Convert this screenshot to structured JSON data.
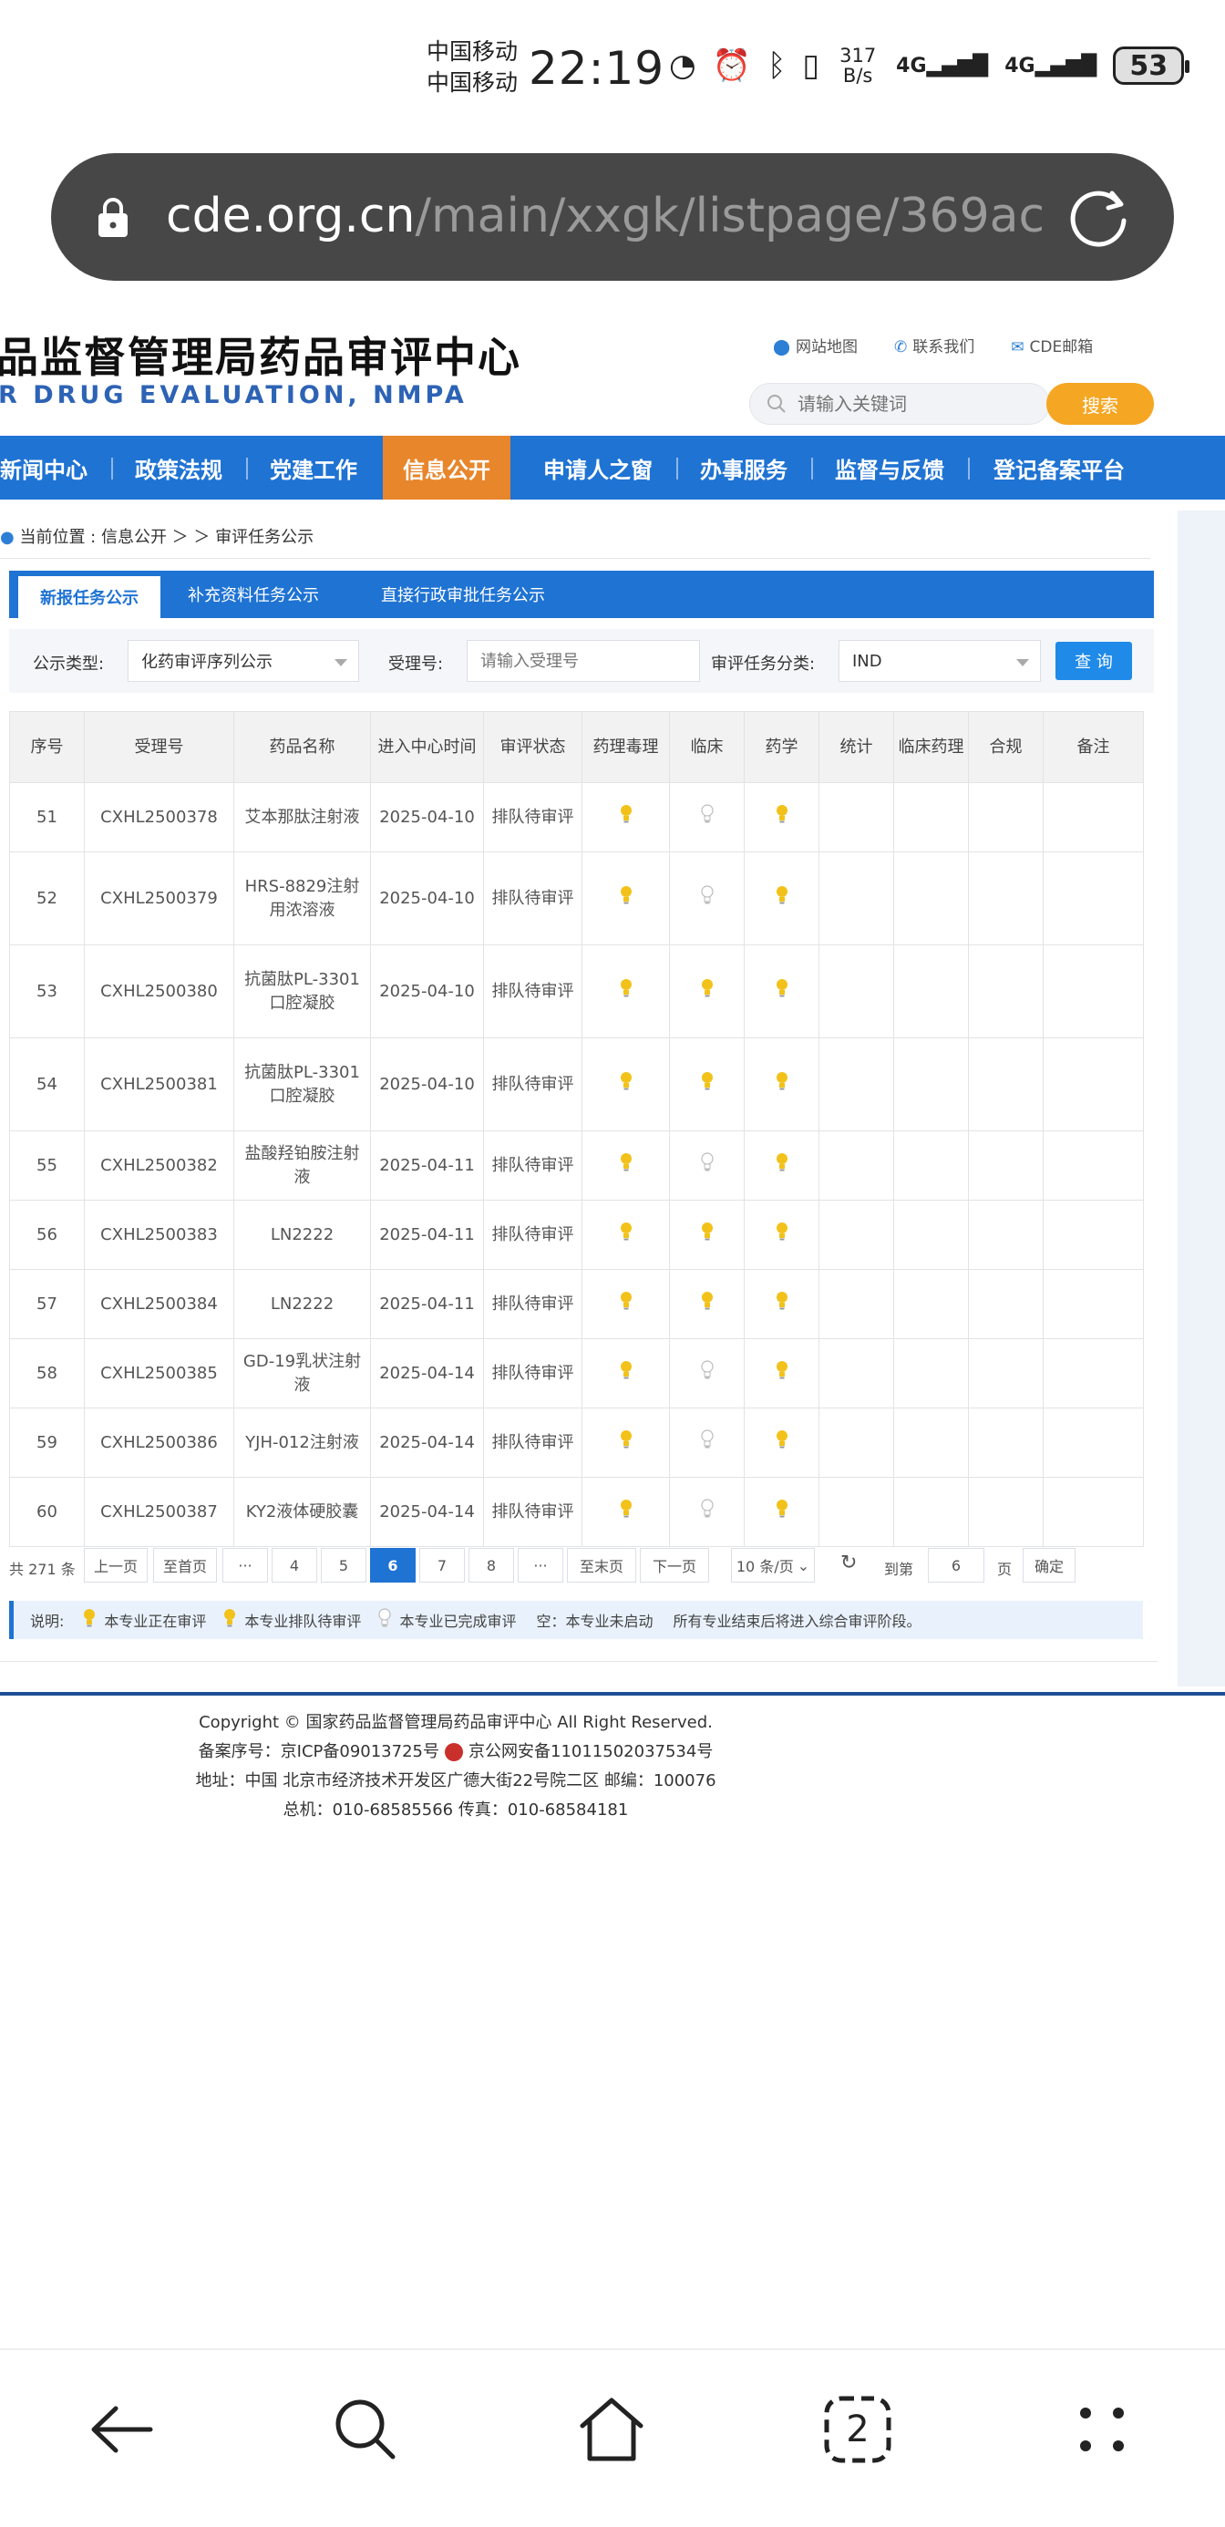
{
  "status_bar": {
    "carrier1": "中国移动",
    "carrier2": "中国移动",
    "time": "22:19",
    "net_speed_value": "317",
    "net_speed_unit": "B/s",
    "network1": "4G",
    "network2": "4G",
    "battery": "53"
  },
  "url_bar": {
    "host": "cde.org.cn",
    "path": "/main/xxgk/listpage/369ac"
  },
  "site": {
    "title": "品监督管理局药品审评中心",
    "subtitle": "R DRUG EVALUATION, NMPA",
    "links": [
      "网站地图",
      "联系我们",
      "CDE邮箱"
    ],
    "search_placeholder": "请输入关键词",
    "search_button": "搜索"
  },
  "nav": {
    "items": [
      "新闻中心",
      "政策法规",
      "党建工作",
      "信息公开",
      "申请人之窗",
      "办事服务",
      "监督与反馈",
      "登记备案平台"
    ],
    "active": "信息公开"
  },
  "breadcrumb": "当前位置 : 信息公开 ＞ ＞ 审评任务公示",
  "tabs": [
    "新报任务公示",
    "补充资料任务公示",
    "直接行政审批任务公示"
  ],
  "filter": {
    "type_label": "公示类型:",
    "type_value": "化药审评序列公示",
    "accept_label": "受理号:",
    "accept_placeholder": "请输入受理号",
    "category_label": "审评任务分类:",
    "category_value": "IND",
    "query_button": "查 询"
  },
  "table": {
    "headers": [
      "序号",
      "受理号",
      "药品名称",
      "进入中心时间",
      "审评状态",
      "药理毒理",
      "临床",
      "药学",
      "统计",
      "临床药理",
      "合规",
      "备注"
    ],
    "rows": [
      {
        "no": "51",
        "id": "CXHL2500378",
        "name": "艾本那肽注射液",
        "date": "2025-04-10",
        "status": "排队待审评",
        "pharm": "y",
        "clin": "w",
        "chem": "y"
      },
      {
        "no": "52",
        "id": "CXHL2500379",
        "name": "HRS-8829注射用浓溶液",
        "date": "2025-04-10",
        "status": "排队待审评",
        "pharm": "y",
        "clin": "w",
        "chem": "y"
      },
      {
        "no": "53",
        "id": "CXHL2500380",
        "name": "抗菌肽PL-3301口腔凝胶",
        "date": "2025-04-10",
        "status": "排队待审评",
        "pharm": "y",
        "clin": "y",
        "chem": "y"
      },
      {
        "no": "54",
        "id": "CXHL2500381",
        "name": "抗菌肽PL-3301口腔凝胶",
        "date": "2025-04-10",
        "status": "排队待审评",
        "pharm": "y",
        "clin": "y",
        "chem": "y"
      },
      {
        "no": "55",
        "id": "CXHL2500382",
        "name": "盐酸羟铂胺注射液",
        "date": "2025-04-11",
        "status": "排队待审评",
        "pharm": "y",
        "clin": "w",
        "chem": "y"
      },
      {
        "no": "56",
        "id": "CXHL2500383",
        "name": "LN2222",
        "date": "2025-04-11",
        "status": "排队待审评",
        "pharm": "y",
        "clin": "y",
        "chem": "y"
      },
      {
        "no": "57",
        "id": "CXHL2500384",
        "name": "LN2222",
        "date": "2025-04-11",
        "status": "排队待审评",
        "pharm": "y",
        "clin": "y",
        "chem": "y"
      },
      {
        "no": "58",
        "id": "CXHL2500385",
        "name": "GD-19乳状注射液",
        "date": "2025-04-14",
        "status": "排队待审评",
        "pharm": "y",
        "clin": "w",
        "chem": "y"
      },
      {
        "no": "59",
        "id": "CXHL2500386",
        "name": "YJH-012注射液",
        "date": "2025-04-14",
        "status": "排队待审评",
        "pharm": "y",
        "clin": "w",
        "chem": "y"
      },
      {
        "no": "60",
        "id": "CXHL2500387",
        "name": "KY2液体硬胶囊",
        "date": "2025-04-14",
        "status": "排队待审评",
        "pharm": "y",
        "clin": "w",
        "chem": "y"
      }
    ]
  },
  "pager": {
    "total": "共 271 条",
    "prev": "上一页",
    "first": "至首页",
    "ellipsis": "···",
    "pages": [
      "4",
      "5",
      "6",
      "7",
      "8"
    ],
    "current": "6",
    "last": "至末页",
    "next": "下一页",
    "page_size": "10 条/页",
    "goto_label": "到第",
    "goto_value": "6",
    "page_unit": "页",
    "confirm": "确定"
  },
  "legend": {
    "title": "说明:",
    "in_progress": "本专业正在审评",
    "queued": "本专业排队待审评",
    "done": "本专业已完成审评",
    "empty": "空：本专业未启动",
    "note": "所有专业结束后将进入综合审评阶段。"
  },
  "footer": {
    "copyright": "Copyright © 国家药品监督管理局药品审评中心    All Right Reserved.",
    "icp": "备案序号：京ICP备09013725号",
    "police": "京公网安备11011502037534号",
    "address": "地址：中国 北京市经济技术开发区广德大街22号院二区     邮编：100076",
    "phone": "总机：010-68585566      传真：010-68584181"
  },
  "colors": {
    "nav_blue": "#1f73d3",
    "active_orange": "#e8862c",
    "bulb_yellow": "#f2c21b",
    "search_orange": "#f5a623"
  },
  "bottom_nav": {
    "tab_count": "2",
    "icons": [
      "back-arrow-icon",
      "search-icon",
      "home-icon",
      "tabs-icon",
      "menu-dots-icon"
    ]
  }
}
